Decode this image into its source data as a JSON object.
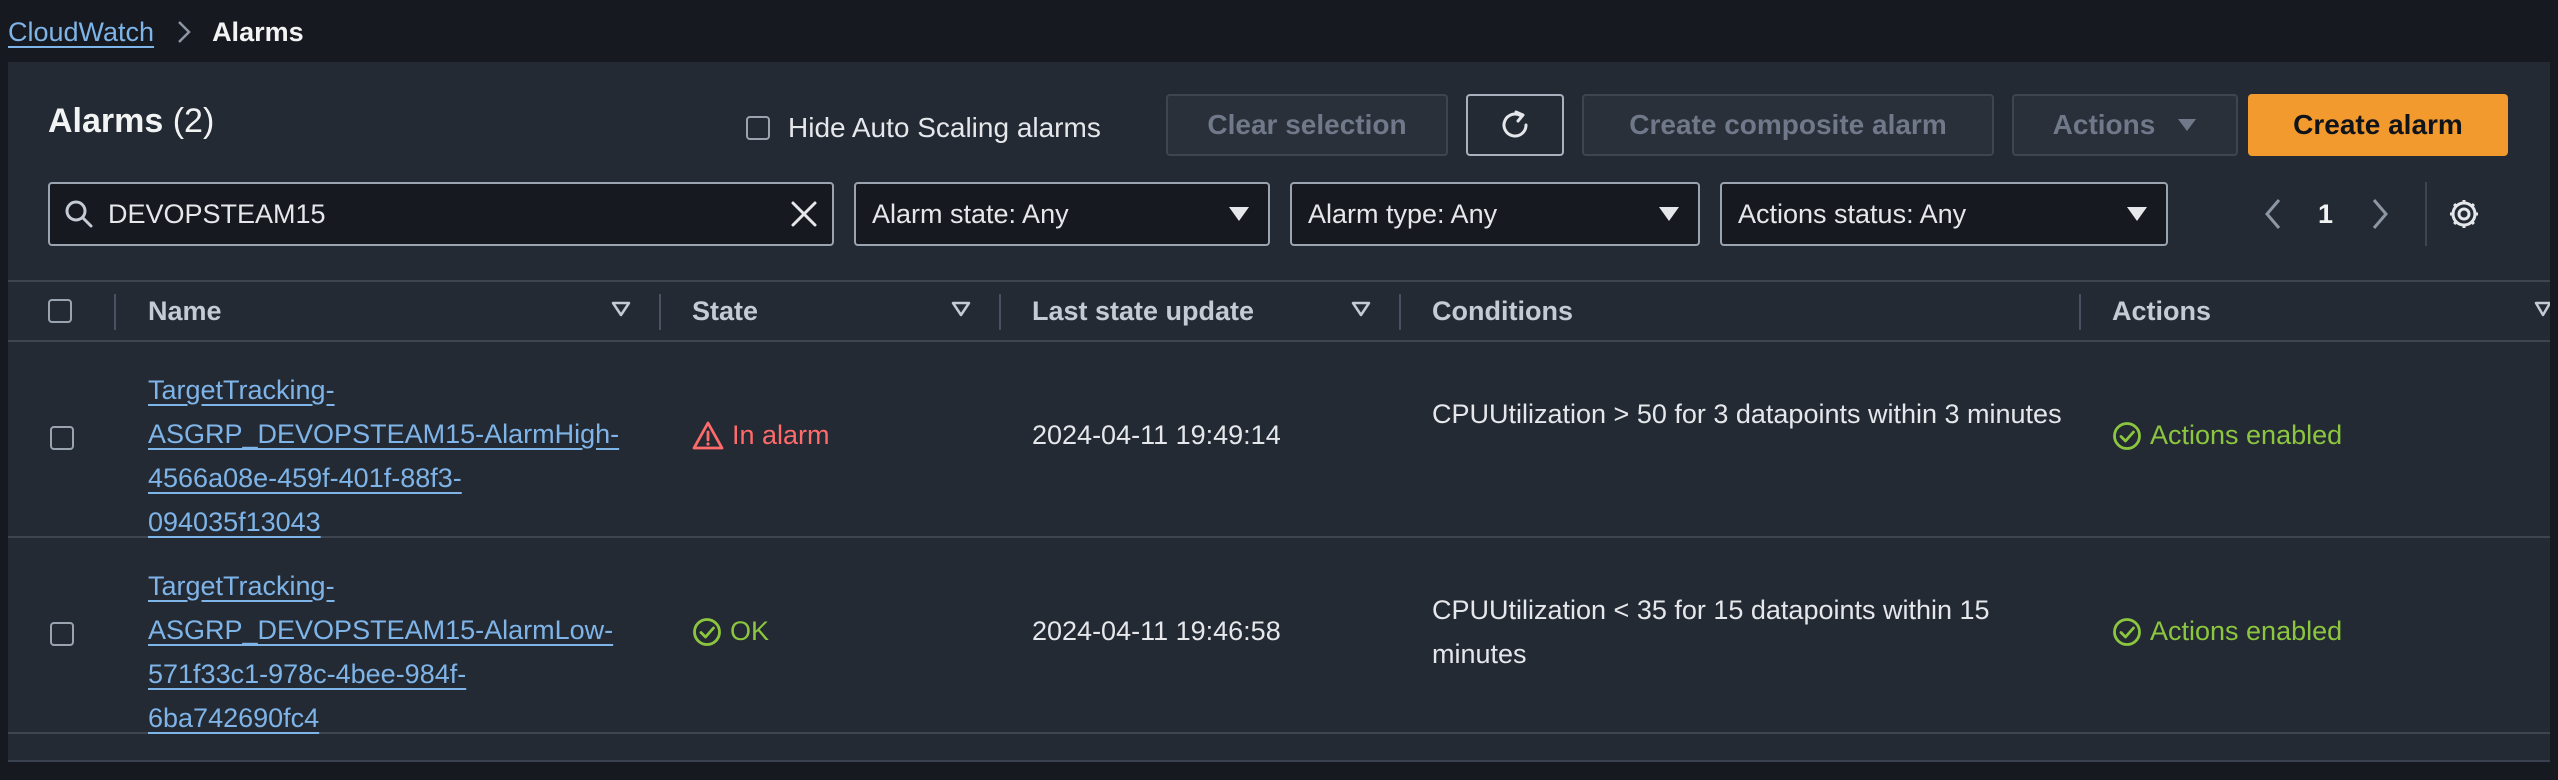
{
  "breadcrumb": {
    "parent": "CloudWatch",
    "current": "Alarms"
  },
  "header": {
    "title": "Alarms",
    "count": "(2)",
    "hide_autoscaling_label": "Hide Auto Scaling alarms",
    "clear_selection_label": "Clear selection",
    "create_composite_label": "Create composite alarm",
    "actions_label": "Actions",
    "create_alarm_label": "Create alarm"
  },
  "filters": {
    "search_value": "DEVOPSTEAM15",
    "alarm_state": "Alarm state: Any",
    "alarm_type": "Alarm type: Any",
    "actions_status": "Actions status: Any",
    "page": "1"
  },
  "table": {
    "columns": {
      "name": "Name",
      "state": "State",
      "last_update": "Last state update",
      "conditions": "Conditions",
      "actions": "Actions"
    },
    "rows": [
      {
        "name": "TargetTracking-ASGRP_DEVOPSTEAM15-AlarmHigh-4566a08e-459f-401f-88f3-094035f13043",
        "name_lines": [
          "TargetTracking-",
          "ASGRP_DEVOPSTEAM15-AlarmHigh-",
          "4566a08e-459f-401f-88f3-",
          "094035f13043"
        ],
        "state": "In alarm",
        "last_update": "2024-04-11 19:49:14",
        "conditions": "CPUUtilization > 50 for 3 datapoints within 3 minutes",
        "actions": "Actions enabled"
      },
      {
        "name": "TargetTracking-ASGRP_DEVOPSTEAM15-AlarmLow-571f33c1-978c-4bee-984f-6ba742690fc4",
        "name_lines": [
          "TargetTracking-",
          "ASGRP_DEVOPSTEAM15-AlarmLow-",
          "571f33c1-978c-4bee-984f-",
          "6ba742690fc4"
        ],
        "state": "OK",
        "last_update": "2024-04-11 19:46:58",
        "conditions": "CPUUtilization < 35 for 15 datapoints within 15 minutes",
        "actions": "Actions enabled"
      }
    ]
  },
  "colors": {
    "link": "#7fb4e8",
    "alarm": "#ff6b6b",
    "ok": "#8cc63f",
    "primary": "#f29a2e",
    "panel": "#232a33"
  }
}
